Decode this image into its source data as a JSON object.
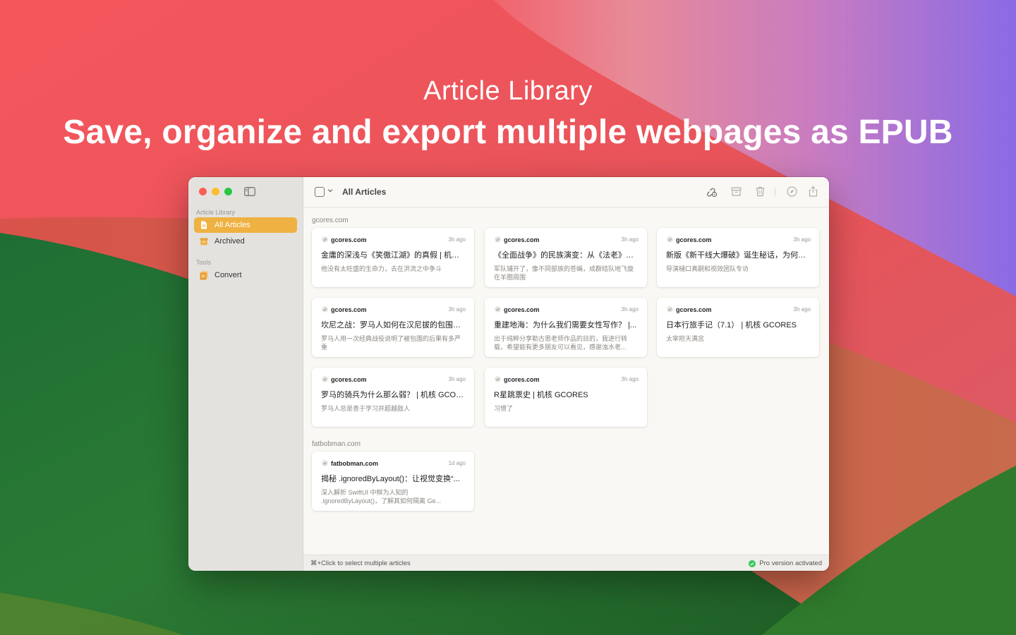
{
  "hero": {
    "subtitle": "Article Library",
    "title": "Save, organize and export multiple webpages as EPUB"
  },
  "colors": {
    "accent": "#efb142",
    "sidebar_bg": "#e4e2df",
    "content_bg": "#faf8f4",
    "pro_badge": "#34c759"
  },
  "sidebar": {
    "section_library": "Article Library",
    "items": [
      {
        "label": "All Articles",
        "icon": "document-icon",
        "active": true
      },
      {
        "label": "Archived",
        "icon": "archive-box-icon",
        "active": false
      }
    ],
    "section_tools": "Tools",
    "tools": [
      {
        "label": "Convert",
        "icon": "convert-icon"
      }
    ]
  },
  "toolbar": {
    "title": "All Articles",
    "icons": [
      "link-gear-icon",
      "archive-icon",
      "trash-icon",
      "compass-icon",
      "share-icon"
    ]
  },
  "groups": [
    {
      "label": "gcores.com",
      "articles": [
        {
          "domain": "gcores.com",
          "time": "3h ago",
          "title": "金庸的深浅与《笑傲江湖》的真假 | 机核 G...",
          "desc": "他没有太旺盛的生命力，去在洪流之中争斗"
        },
        {
          "domain": "gcores.com",
          "time": "3h ago",
          "title": "《全面战争》的民族演变：从《法老》到...",
          "desc": "军队铺开了，像不同部族的苍蝇，成群结队地飞旋在羊圈周围"
        },
        {
          "domain": "gcores.com",
          "time": "3h ago",
          "title": "新版《新干线大爆破》诞生秘话，为何选...",
          "desc": "导演樋口真嗣和视效团队专访"
        },
        {
          "domain": "gcores.com",
          "time": "3h ago",
          "title": "坎尼之战：罗马人如何在汉尼拔的包围下...",
          "desc": "罗马人用一次经典战役说明了被包围的后果有多严重"
        },
        {
          "domain": "gcores.com",
          "time": "3h ago",
          "title": "重建地海：为什么我们需要女性写作？ |...",
          "desc": "出于纯粹分享勒古恩老师作品的目的，我进行转载，希望能有更多朋友可以看见，感谢浊水老..."
        },
        {
          "domain": "gcores.com",
          "time": "3h ago",
          "title": "日本行旅手记（7.1） | 机核 GCORES",
          "desc": "太宰府天满宫"
        },
        {
          "domain": "gcores.com",
          "time": "3h ago",
          "title": "罗马的骑兵为什么那么弱？ | 机核 GCORES",
          "desc": "罗马人总是善于学习并超越敌人"
        },
        {
          "domain": "gcores.com",
          "time": "3h ago",
          "title": "R星跳票史 | 机核 GCORES",
          "desc": "习惯了"
        }
      ]
    },
    {
      "label": "fatbobman.com",
      "articles": [
        {
          "domain": "fatbobman.com",
          "time": "1d ago",
          "title": "揭秘 .ignoredByLayout()：让视觉变换“...",
          "desc": "深入解析 SwiftUI 中鲜为人知的 .ignoredByLayout()，了解其如何隔离 Ge..."
        }
      ]
    }
  ],
  "status": {
    "hint": "⌘+Click to select multiple articles",
    "pro": "Pro version activated"
  }
}
